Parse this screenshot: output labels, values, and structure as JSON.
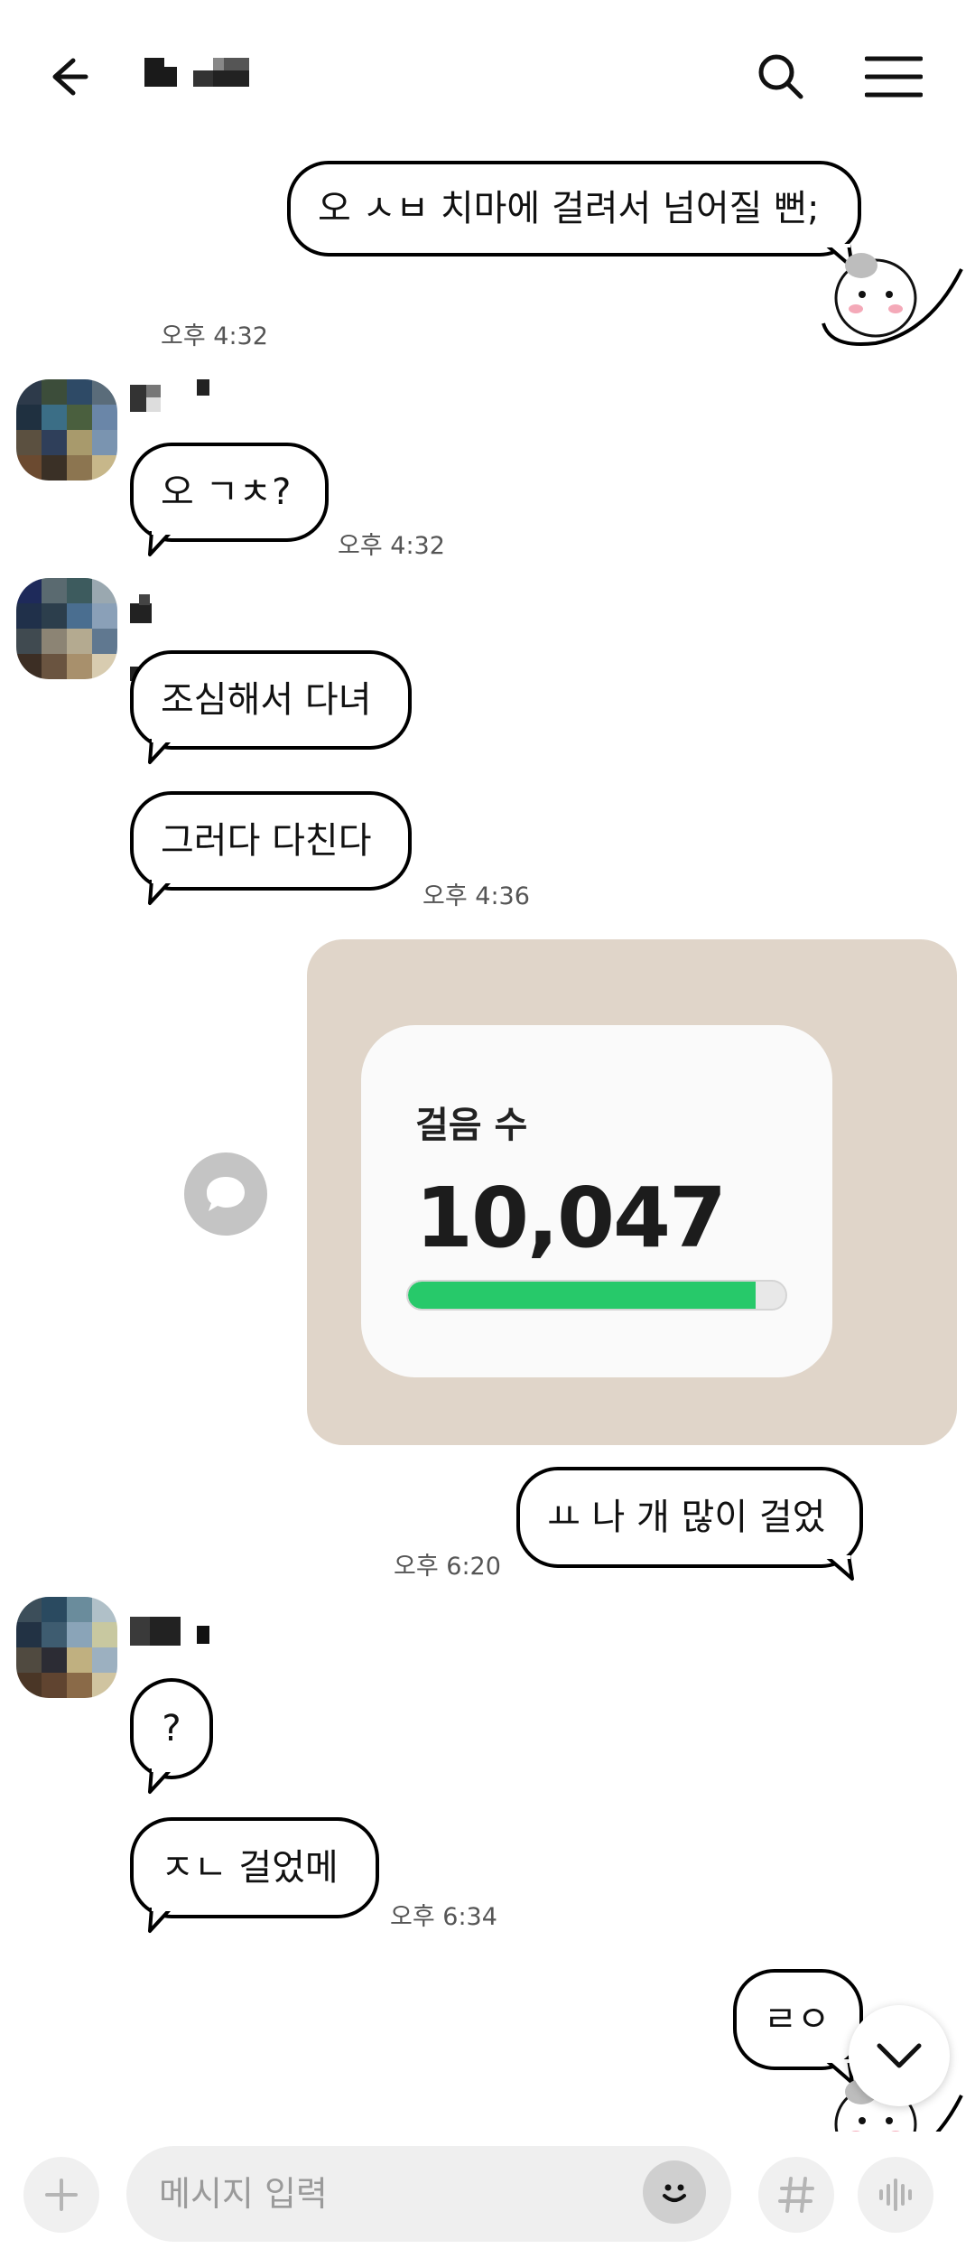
{
  "header": {
    "back_icon": "arrow-left-icon",
    "search_icon": "search-icon",
    "menu_icon": "hamburger-menu-icon"
  },
  "messages": [
    {
      "side": "right",
      "text": "오 ㅅㅂ 치마에 걸려서 넘어질 뻔;",
      "time": "오후 4:32"
    },
    {
      "side": "left",
      "text": "오 ㄱㅊ?",
      "time": "오후 4:32"
    },
    {
      "side": "left",
      "text": "조심해서 다녀",
      "time": ""
    },
    {
      "side": "left",
      "text": "그러다 다친다",
      "time": "오후 4:36"
    },
    {
      "side": "right",
      "text": "ㅛ 나 개 많이 걸었",
      "time": "오후 6:20"
    },
    {
      "side": "left",
      "text": "?",
      "time": ""
    },
    {
      "side": "left",
      "text": "ㅈㄴ 걸었메",
      "time": "오후 6:34"
    },
    {
      "side": "right",
      "text": "ㄹㅇ",
      "time": ""
    }
  ],
  "step_card": {
    "label": "걸음 수",
    "value": "10,047",
    "progress_fraction": 0.92,
    "accent": "#27c96a",
    "background": "#e0d5c9"
  },
  "input": {
    "placeholder": "메시지 입력"
  },
  "colors": {
    "bubble_border": "#000000",
    "timestamp": "#555555"
  }
}
